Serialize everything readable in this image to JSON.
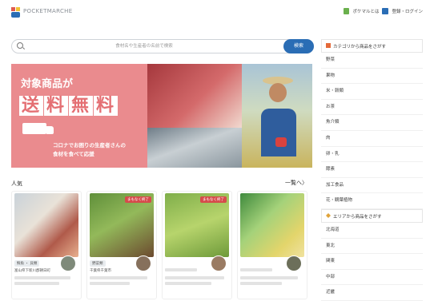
{
  "header": {
    "logo_text": "POCKETMARCHE",
    "about_link": "ポケマルとは",
    "login_link": "登録・ログイン"
  },
  "search": {
    "placeholder": "食材名や生産者の名前で検索",
    "button": "検索"
  },
  "banner": {
    "line1": "対象商品が",
    "line2_chars": [
      "送",
      "料",
      "無",
      "料"
    ],
    "sub1": "コロナでお困りの生産者さんの",
    "sub2": "食材を食べて応援"
  },
  "popular": {
    "title": "人気",
    "more": "一覧へ〉"
  },
  "cards": [
    {
      "tag": "鮮魚 ・ 貝類",
      "seller": "富山県下新川郡朝日町",
      "badge": ""
    },
    {
      "tag": "野菜類",
      "seller": "千葉県千葉市",
      "badge": "まもなく終了"
    },
    {
      "tag": "",
      "seller": "",
      "badge": "まもなく終了"
    },
    {
      "tag": "",
      "seller": "",
      "badge": ""
    }
  ],
  "sidebar": {
    "category_header": "カテゴリから商品をさがす",
    "categories": [
      "野菜",
      "果物",
      "米・穀類",
      "お茶",
      "魚介類",
      "肉",
      "卵・乳",
      "酵素",
      "加工食品",
      "花・観葉植物"
    ],
    "area_header": "エリアから商品をさがす",
    "areas": [
      "北海道",
      "東北",
      "関東",
      "中部",
      "近畿"
    ]
  },
  "colors": {
    "accent_blue": "#2a6db5",
    "banner_pink": "#ea8b8e",
    "badge_red": "#d64b4b"
  }
}
